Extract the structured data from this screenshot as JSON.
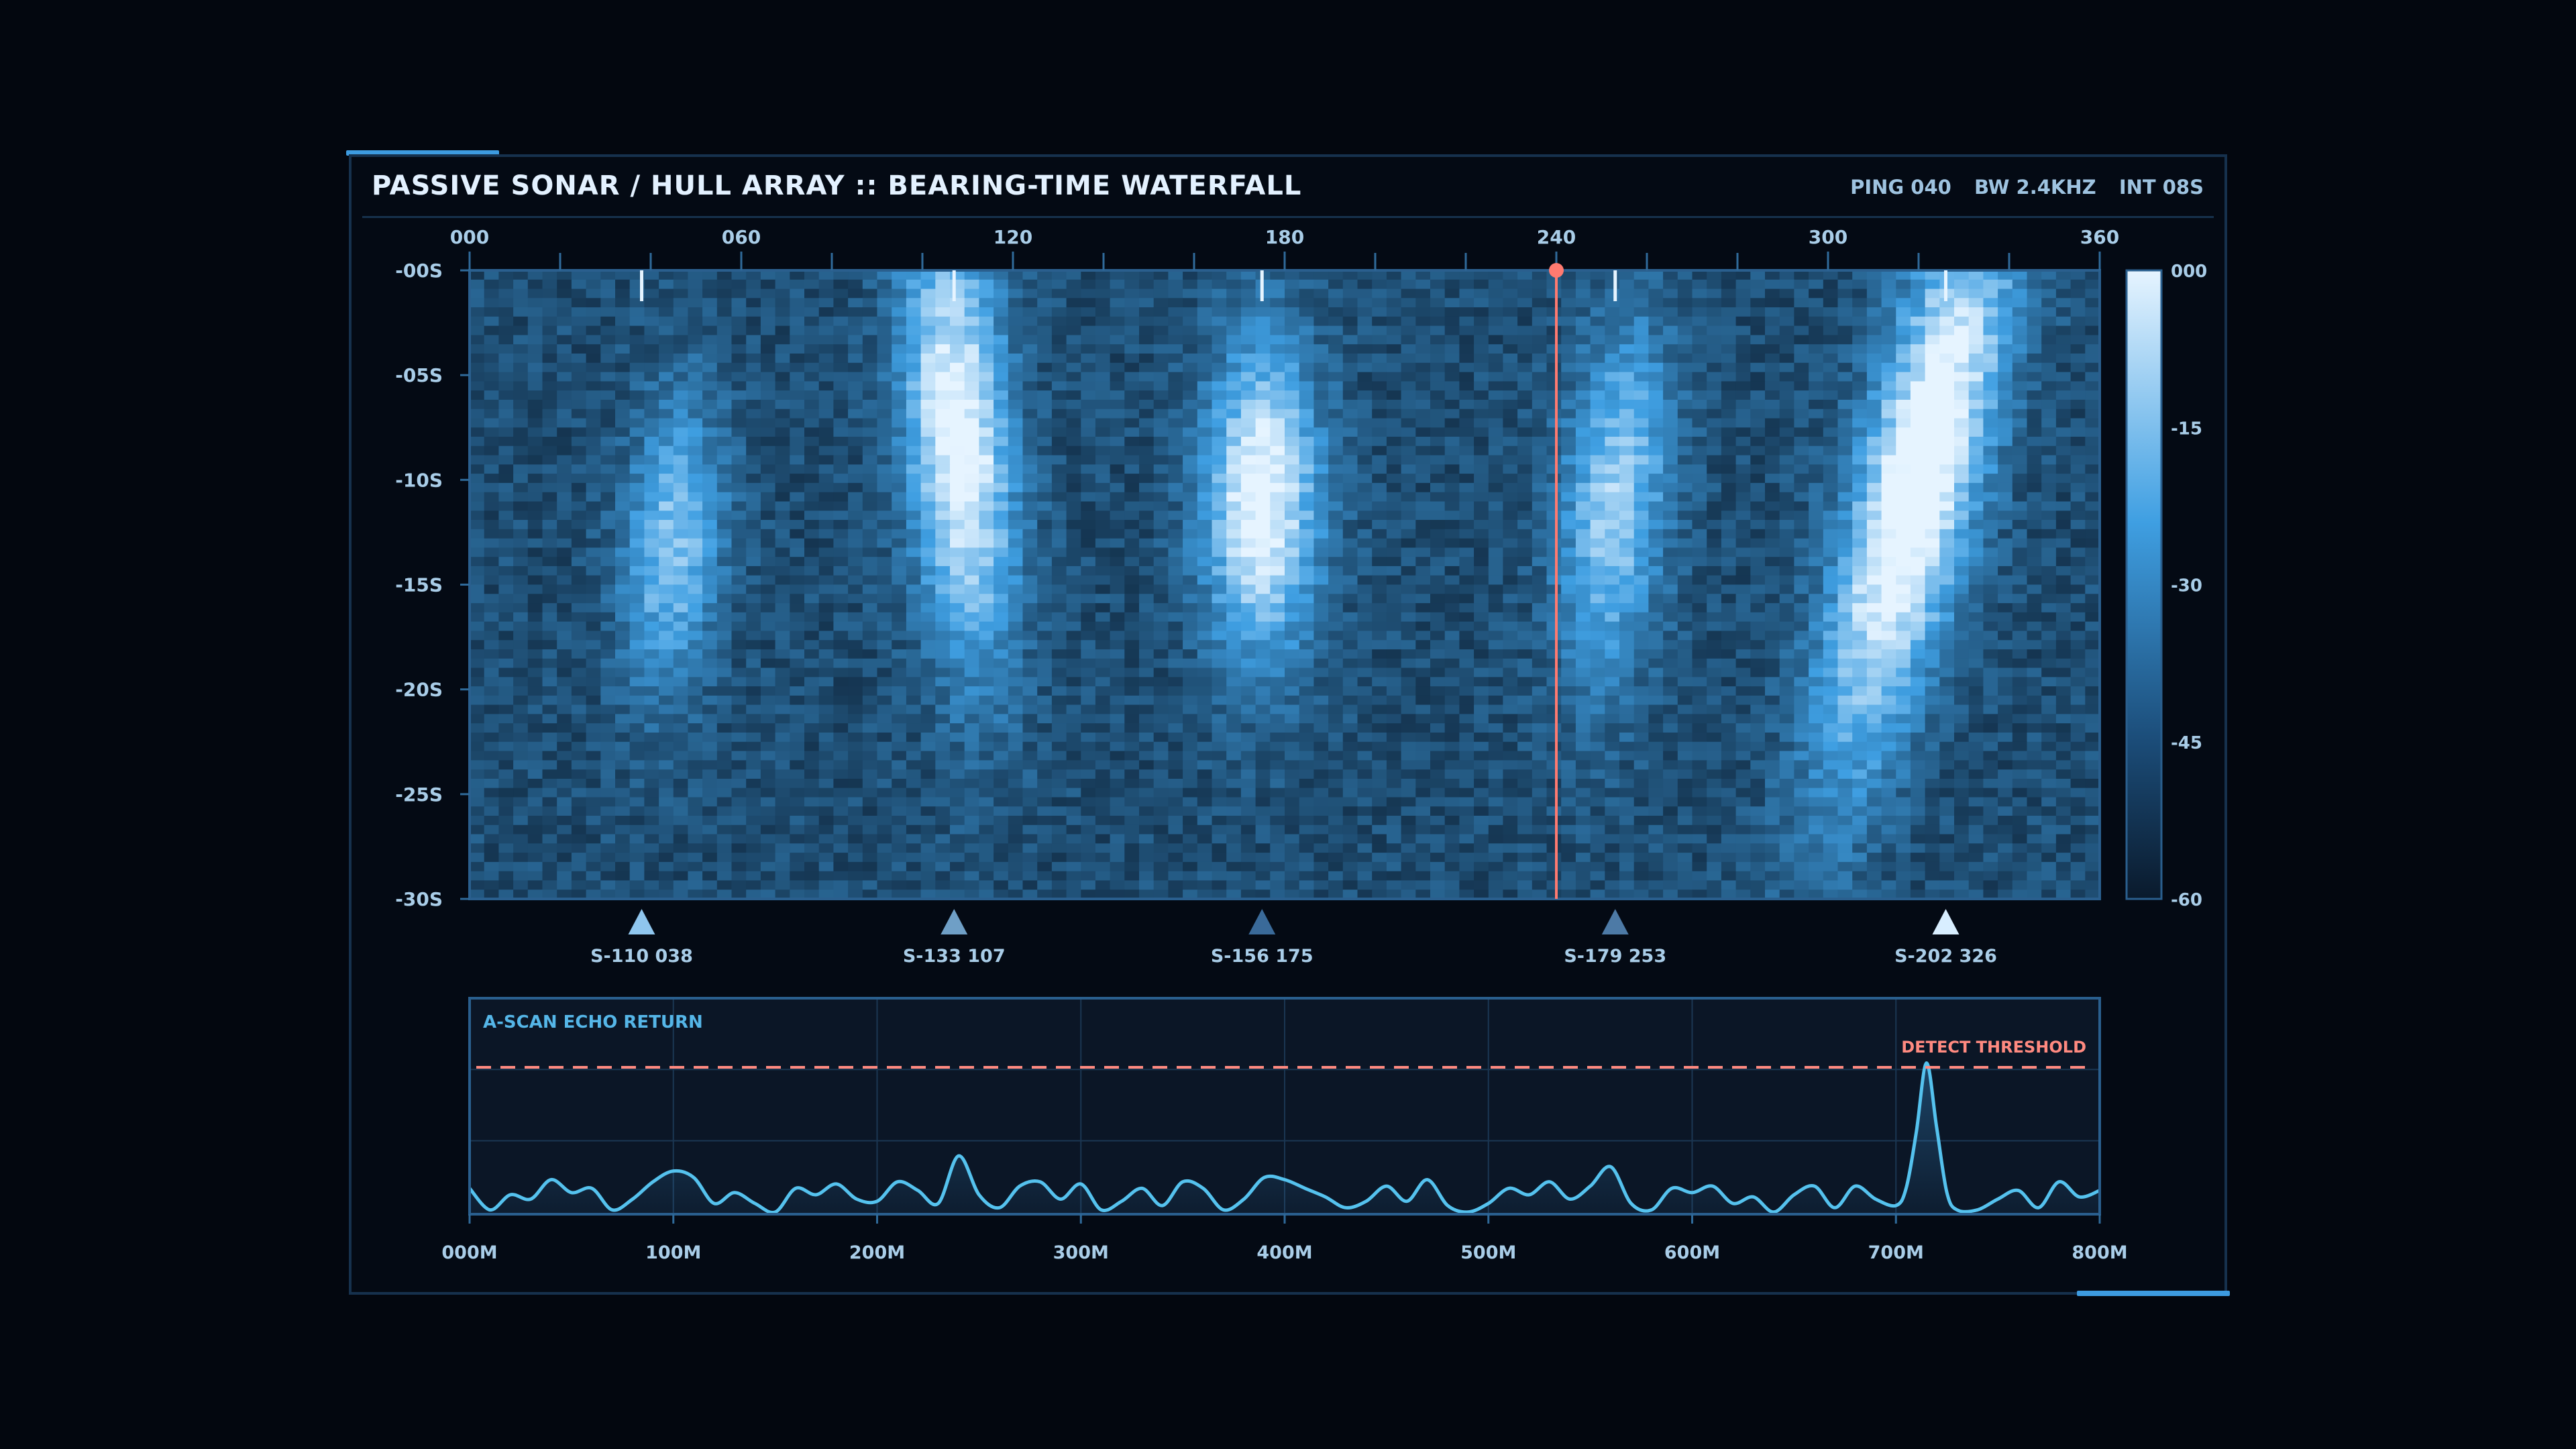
{
  "header": {
    "title": "PASSIVE SONAR / HULL ARRAY  ::  BEARING-TIME WATERFALL",
    "readouts": [
      "PING 040",
      "BW 2.4KHZ",
      "INT 08S"
    ]
  },
  "colors": {
    "background": "#03070f",
    "panel_border": "#16314d",
    "accent": "#3d9be0",
    "signal_low": "#0a1a2c",
    "signal_high": "#e6f4ff",
    "cursor": "#ff7a70",
    "threshold": "#ff8a80",
    "trace": "#55c2ee"
  },
  "chart_data": [
    {
      "type": "heatmap",
      "title": "",
      "x_ticks": [
        "000",
        "060",
        "120",
        "180",
        "240",
        "300",
        "360"
      ],
      "x_tick_values": [
        0,
        60,
        120,
        180,
        240,
        300,
        360
      ],
      "xlim": [
        0,
        360
      ],
      "y_ticks": [
        "-00S",
        "-05S",
        "-10S",
        "-15S",
        "-20S",
        "-25S",
        "-30S"
      ],
      "y_tick_values": [
        0,
        -5,
        -10,
        -15,
        -20,
        -25,
        -30
      ],
      "ylim": [
        0,
        -30
      ],
      "colorbar": {
        "labels": [
          "000",
          "-15",
          "-30",
          "-45",
          "-60"
        ],
        "values": [
          0,
          -15,
          -30,
          -45,
          -60
        ]
      },
      "cursor_bearing": 240,
      "tracks": [
        {
          "label": "S-110 038",
          "bearing": 38,
          "top_ticks": [
            38
          ]
        },
        {
          "label": "S-133 107",
          "bearing": 107
        },
        {
          "label": "S-156 175",
          "bearing": 175
        },
        {
          "label": "S-179 253",
          "bearing": 253
        },
        {
          "label": "S-202 326",
          "bearing": 326
        }
      ],
      "top_tick_bearings": [
        38,
        107,
        175,
        253,
        326
      ]
    },
    {
      "type": "line",
      "title": "A-SCAN ECHO RETURN",
      "x_ticks": [
        "000M",
        "100M",
        "200M",
        "300M",
        "400M",
        "500M",
        "600M",
        "700M",
        "800M"
      ],
      "x_tick_values": [
        0,
        100,
        200,
        300,
        400,
        500,
        600,
        700,
        800
      ],
      "xlim": [
        0,
        800
      ],
      "ylim": [
        0,
        1
      ],
      "threshold_label": "DETECT THRESHOLD",
      "threshold": 0.68,
      "peak_range_m": 715,
      "x": [
        0,
        10,
        20,
        30,
        40,
        50,
        60,
        70,
        80,
        90,
        100,
        110,
        120,
        130,
        140,
        150,
        160,
        170,
        180,
        190,
        200,
        210,
        220,
        230,
        240,
        250,
        260,
        270,
        280,
        290,
        300,
        310,
        320,
        330,
        340,
        350,
        360,
        370,
        380,
        390,
        400,
        410,
        420,
        430,
        440,
        450,
        460,
        470,
        480,
        490,
        500,
        510,
        520,
        530,
        540,
        550,
        560,
        570,
        580,
        590,
        600,
        610,
        620,
        630,
        640,
        650,
        660,
        670,
        680,
        690,
        700,
        705,
        710,
        715,
        720,
        725,
        730,
        740,
        750,
        760,
        770,
        780,
        790,
        800
      ],
      "y": [
        0.12,
        0.02,
        0.09,
        0.07,
        0.16,
        0.1,
        0.12,
        0.02,
        0.07,
        0.15,
        0.2,
        0.17,
        0.05,
        0.1,
        0.05,
        0.01,
        0.12,
        0.09,
        0.14,
        0.07,
        0.06,
        0.15,
        0.11,
        0.05,
        0.27,
        0.09,
        0.03,
        0.13,
        0.15,
        0.07,
        0.14,
        0.02,
        0.06,
        0.12,
        0.04,
        0.15,
        0.12,
        0.02,
        0.07,
        0.17,
        0.16,
        0.12,
        0.08,
        0.03,
        0.06,
        0.13,
        0.06,
        0.16,
        0.04,
        0.01,
        0.05,
        0.12,
        0.09,
        0.15,
        0.07,
        0.13,
        0.22,
        0.05,
        0.02,
        0.12,
        0.1,
        0.13,
        0.05,
        0.08,
        0.01,
        0.09,
        0.13,
        0.03,
        0.13,
        0.07,
        0.04,
        0.12,
        0.38,
        0.7,
        0.4,
        0.1,
        0.02,
        0.02,
        0.07,
        0.11,
        0.03,
        0.15,
        0.08,
        0.11
      ]
    }
  ]
}
